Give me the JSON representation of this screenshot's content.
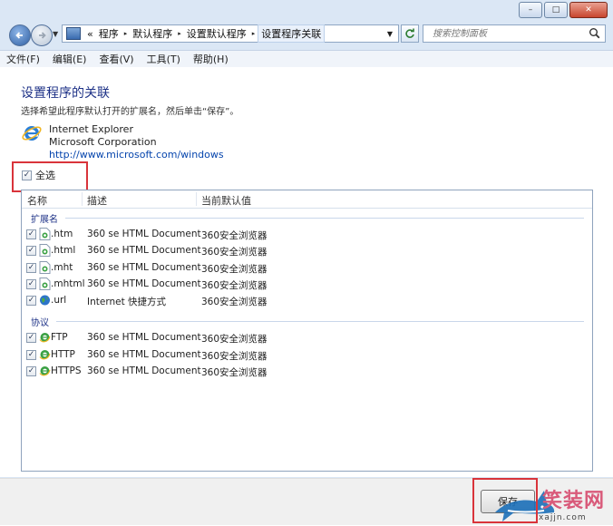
{
  "window": {
    "caption": {
      "minimize": "–",
      "maximize": "□",
      "close": "✕"
    }
  },
  "nav": {
    "breadcrumb": {
      "overflow": "«",
      "items": [
        "程序",
        "默认程序",
        "设置默认程序",
        "设置程序关联"
      ],
      "separator": "▸"
    },
    "search_placeholder": "搜索控制面板"
  },
  "menu": [
    "文件(F)",
    "编辑(E)",
    "查看(V)",
    "工具(T)",
    "帮助(H)"
  ],
  "page": {
    "title": "设置程序的关联",
    "description": "选择希望此程序默认打开的扩展名，然后单击“保存”。",
    "program": {
      "name": "Internet Explorer",
      "company": "Microsoft Corporation",
      "url": "http://www.microsoft.com/windows"
    },
    "select_all": "全选"
  },
  "list": {
    "columns": [
      "名称",
      "描述",
      "当前默认值"
    ],
    "groups": [
      {
        "label": "扩展名",
        "rows": [
          {
            "name": ".htm",
            "desc": "360 se HTML Document",
            "default": "360安全浏览器",
            "checked": true,
            "icon": "html-file-icon"
          },
          {
            "name": ".html",
            "desc": "360 se HTML Document",
            "default": "360安全浏览器",
            "checked": true,
            "icon": "html-file-icon"
          },
          {
            "name": ".mht",
            "desc": "360 se HTML Document",
            "default": "360安全浏览器",
            "checked": true,
            "icon": "html-file-icon"
          },
          {
            "name": ".mhtml",
            "desc": "360 se HTML Document",
            "default": "360安全浏览器",
            "checked": true,
            "icon": "html-file-icon"
          },
          {
            "name": ".url",
            "desc": "Internet 快捷方式",
            "default": "360安全浏览器",
            "checked": true,
            "icon": "globe-icon"
          }
        ]
      },
      {
        "label": "协议",
        "rows": [
          {
            "name": "FTP",
            "desc": "360 se HTML Document",
            "default": "360安全浏览器",
            "checked": true,
            "icon": "browser-e-icon"
          },
          {
            "name": "HTTP",
            "desc": "360 se HTML Document",
            "default": "360安全浏览器",
            "checked": true,
            "icon": "browser-e-icon"
          },
          {
            "name": "HTTPS",
            "desc": "360 se HTML Document",
            "default": "360安全浏览器",
            "checked": true,
            "icon": "browser-e-icon"
          }
        ]
      }
    ]
  },
  "footer": {
    "save_label": "保存"
  },
  "watermark": {
    "text": "笑装网",
    "url": "xajjn.com"
  },
  "colors": {
    "highlight": "#d9343b",
    "heading": "#1e3287",
    "link": "#0645ad"
  }
}
